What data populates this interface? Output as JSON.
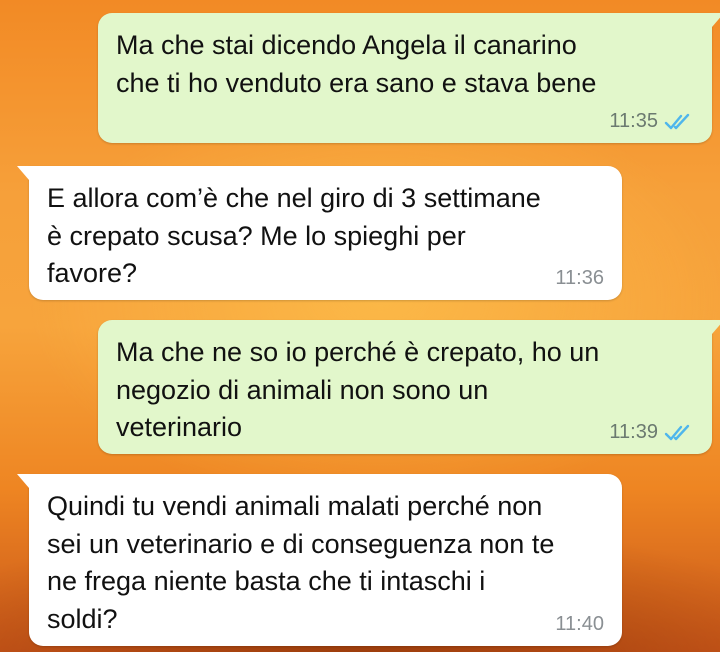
{
  "colors": {
    "outgoing_bubble": "#e2f7cb",
    "incoming_bubble": "#ffffff",
    "read_ticks": "#4fb6ec",
    "wallpaper": "#f6a03a"
  },
  "messages": [
    {
      "direction": "outgoing",
      "text": "Ma che stai dicendo Angela il canarino\nche ti ho venduto era sano e stava bene",
      "time": "11:35",
      "status_icon": "double-check-read-icon"
    },
    {
      "direction": "incoming",
      "text": "E allora com’è che nel giro di 3 settimane\nè crepato scusa? Me lo spieghi per\nfavore?",
      "time": "11:36"
    },
    {
      "direction": "outgoing",
      "text": "Ma che ne so io perché è crepato, ho un\nnegozio di animali non sono un\nveterinario",
      "time": "11:39",
      "status_icon": "double-check-read-icon"
    },
    {
      "direction": "incoming",
      "text": "Quindi tu vendi animali malati perché non\nsei un veterinario e di conseguenza non te\nne frega niente basta che ti intaschi i\nsoldi?",
      "time": "11:40"
    }
  ]
}
